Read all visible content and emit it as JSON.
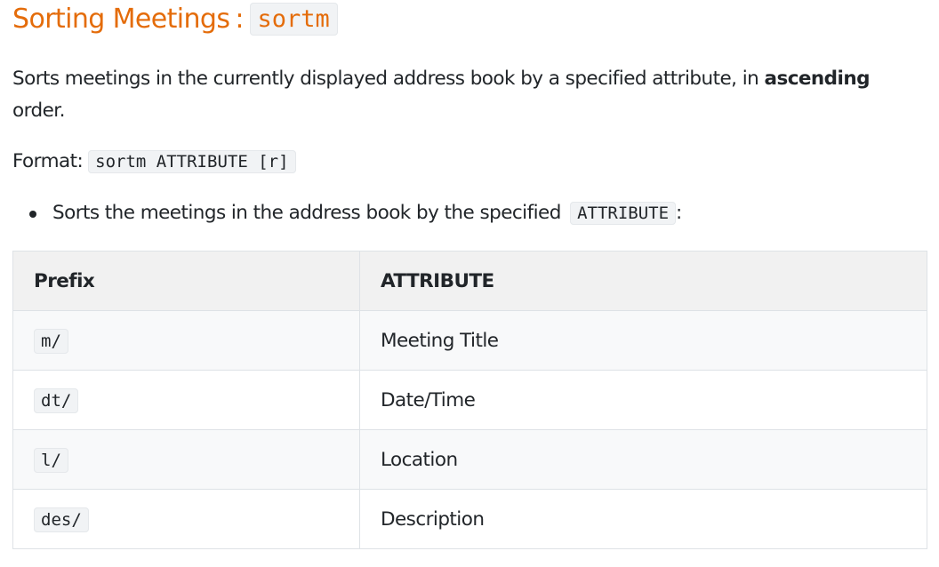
{
  "heading": {
    "title": "Sorting Meetings",
    "separator": ":",
    "command": "sortm"
  },
  "description": {
    "before_bold": "Sorts meetings in the currently displayed address book by a specified attribute, in ",
    "bold": "ascending",
    "after_bold": " order."
  },
  "format": {
    "label": "Format:",
    "code": "sortm ATTRIBUTE [r]"
  },
  "bullet": {
    "text": "Sorts the meetings in the address book by the specified ",
    "code": "ATTRIBUTE",
    "suffix": ":"
  },
  "table": {
    "headers": [
      "Prefix",
      "ATTRIBUTE"
    ],
    "rows": [
      {
        "prefix": "m/",
        "attribute": "Meeting Title"
      },
      {
        "prefix": "dt/",
        "attribute": "Date/Time"
      },
      {
        "prefix": "l/",
        "attribute": "Location"
      },
      {
        "prefix": "des/",
        "attribute": "Description"
      }
    ]
  },
  "colors": {
    "heading": "#e46c0a",
    "code_background": "#f1f3f5",
    "table_header_background": "#f1f1f1",
    "table_stripe": "#f8f9fa",
    "border": "#dee2e6"
  }
}
